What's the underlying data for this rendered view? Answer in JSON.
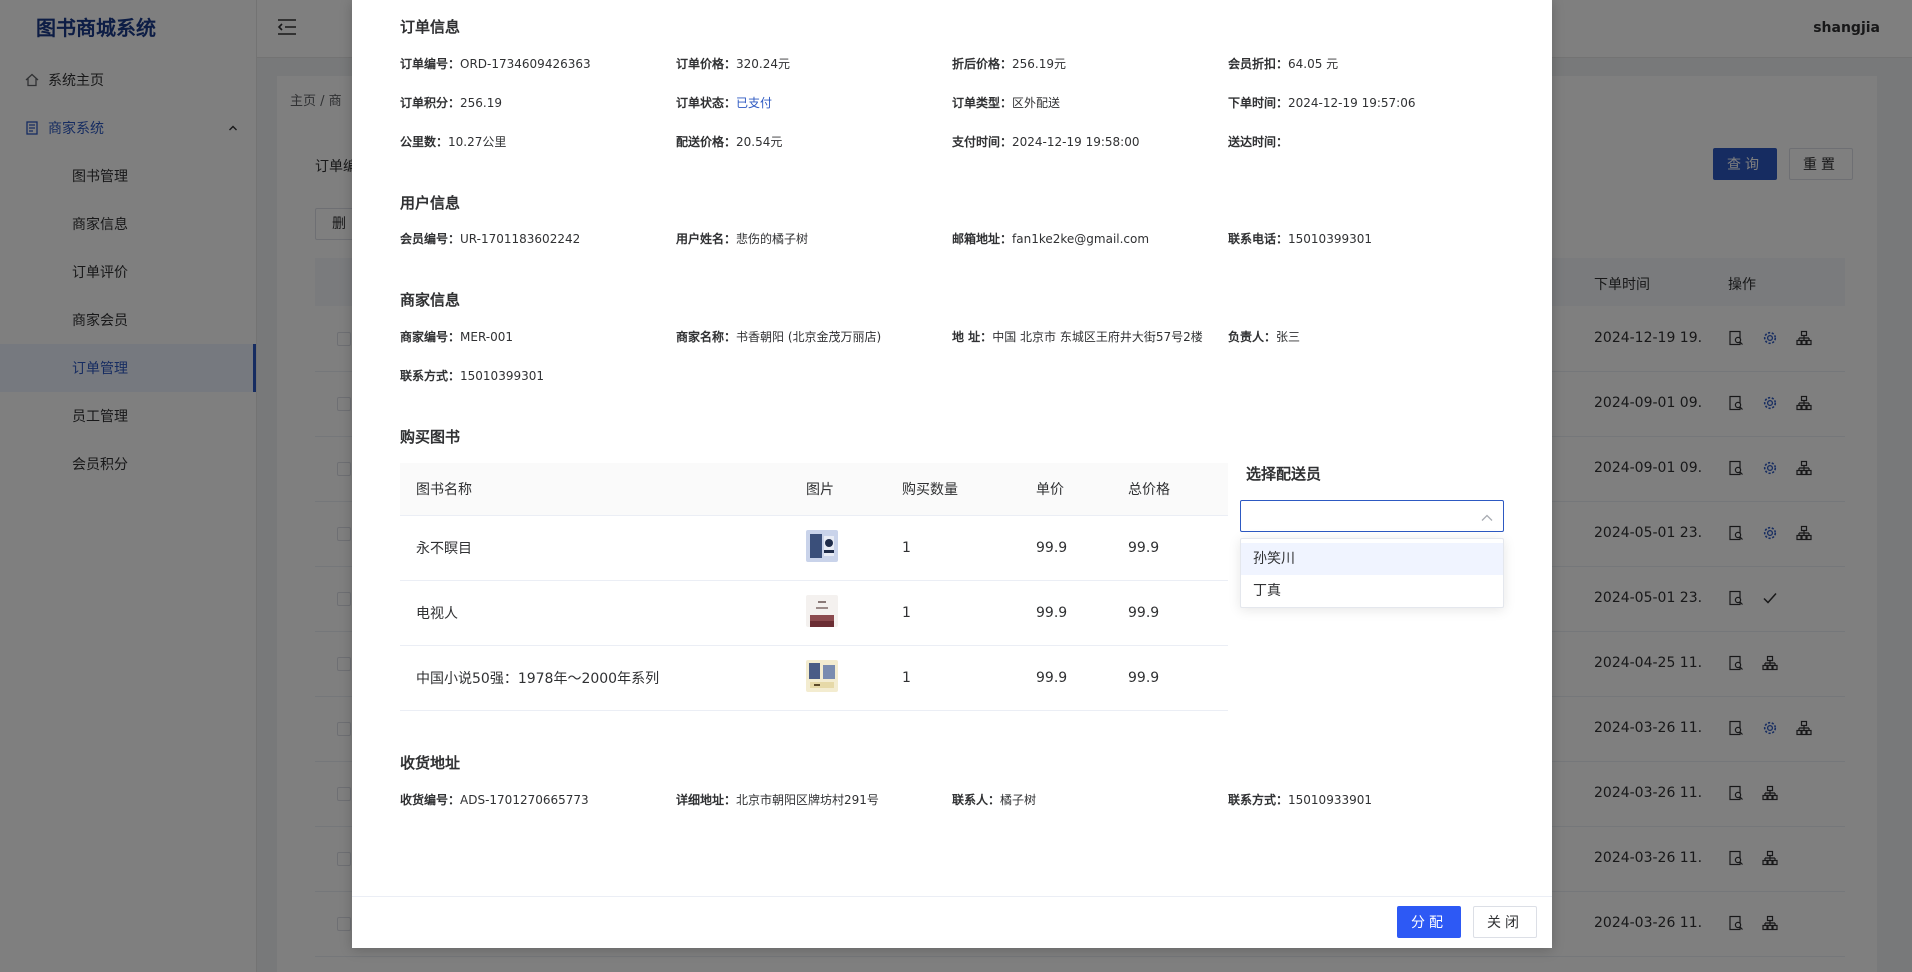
{
  "app": {
    "title": "图书商城系统",
    "user": "shangjia"
  },
  "sidebar": {
    "items": [
      {
        "label": "系统主页",
        "icon": "home-icon"
      },
      {
        "label": "商家系统",
        "icon": "document-icon"
      },
      {
        "label": "图书管理"
      },
      {
        "label": "商家信息"
      },
      {
        "label": "订单评价"
      },
      {
        "label": "商家会员"
      },
      {
        "label": "订单管理"
      },
      {
        "label": "员工管理"
      },
      {
        "label": "会员积分"
      }
    ]
  },
  "background": {
    "breadcrumb": "主页  /  商",
    "query_label": "订单编",
    "query_button": "查询",
    "reset_button": "重置",
    "delete_button": "删",
    "col_time": "下单时间",
    "col_ops": "操作",
    "rows": [
      {
        "time": "2024-12-19 19..."
      },
      {
        "time": "2024-09-01 09..."
      },
      {
        "time": "2024-09-01 09..."
      },
      {
        "time": "2024-05-01 23..."
      },
      {
        "time": "2024-05-01 23..."
      },
      {
        "time": "2024-04-25 11..."
      },
      {
        "time": "2024-03-26 11..."
      },
      {
        "time": "2024-03-26 11..."
      },
      {
        "time": "2024-03-26 11..."
      },
      {
        "time": "2024-03-26 11..."
      }
    ]
  },
  "dialog": {
    "order_section": "订单信息",
    "order": {
      "id_k": "订单编号：",
      "id_v": "ORD-1734609426363",
      "price_k": "订单价格：",
      "price_v": "320.24元",
      "disc_k": "折后价格：",
      "disc_v": "256.19元",
      "member_k": "会员折扣：",
      "member_v": "64.05 元",
      "points_k": "订单积分：",
      "points_v": "256.19",
      "status_k": "订单状态：",
      "status_v": "已支付",
      "type_k": "订单类型：",
      "type_v": "区外配送",
      "ordertime_k": "下单时间：",
      "ordertime_v": "2024-12-19 19:57:06",
      "km_k": "公里数：",
      "km_v": "10.27公里",
      "ship_k": "配送价格：",
      "ship_v": "20.54元",
      "paytime_k": "支付时间：",
      "paytime_v": "2024-12-19 19:58:00",
      "deliver_k": "送达时间：",
      "deliver_v": ""
    },
    "user_section": "用户信息",
    "user": {
      "id_k": "会员编号：",
      "id_v": "UR-1701183602242",
      "name_k": "用户姓名：",
      "name_v": "悲伤的橘子树",
      "email_k": "邮箱地址：",
      "email_v": "fan1ke2ke@gmail.com",
      "phone_k": "联系电话：",
      "phone_v": "15010399301"
    },
    "merchant_section": "商家信息",
    "merchant": {
      "id_k": "商家编号：",
      "id_v": "MER-001",
      "name_k": "商家名称：",
      "name_v": "书香朝阳 (北京金茂万丽店)",
      "addr_k": "地 址：",
      "addr_v": "中国 北京市 东城区王府井大街57号2楼",
      "owner_k": "负责人：",
      "owner_v": "张三",
      "contact_k": "联系方式：",
      "contact_v": "15010399301"
    },
    "books_section": "购买图书",
    "books_head": {
      "name": "图书名称",
      "img": "图片",
      "qty": "购买数量",
      "price": "单价",
      "total": "总价格"
    },
    "books": [
      {
        "name": "永不瞑目",
        "qty": "1",
        "price": "99.9",
        "total": "99.9"
      },
      {
        "name": "电视人",
        "qty": "1",
        "price": "99.9",
        "total": "99.9"
      },
      {
        "name": "中国小说50强：1978年～2000年系列",
        "qty": "1",
        "price": "99.9",
        "total": "99.9"
      }
    ],
    "assign_title": "选择配送员",
    "couriers": [
      "孙笑川",
      "丁真"
    ],
    "address_section": "收货地址",
    "address": {
      "id_k": "收货编号：",
      "id_v": "ADS-1701270665773",
      "detail_k": "详细地址：",
      "detail_v": "北京市朝阳区牌坊村291号",
      "contact_k": "联系人：",
      "contact_v": "橘子树",
      "phone_k": "联系方式：",
      "phone_v": "15010933901"
    },
    "assign_button": "分配",
    "close_button": "关闭"
  },
  "colors": {
    "primary": "#2d59c2",
    "assign": "#2d59f5",
    "paid": "#2d59c2"
  }
}
